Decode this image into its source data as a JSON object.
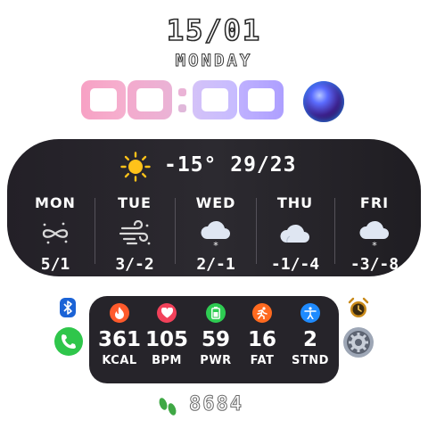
{
  "header": {
    "date": "15/01",
    "day": "MONDAY"
  },
  "clock": {
    "hours": "00",
    "minutes": "00"
  },
  "weather": {
    "current_icon": "sun-icon",
    "current_text": "-15° 29/23",
    "days": [
      {
        "name": "MON",
        "icon": "wind-swirl-icon",
        "temp": "5/1"
      },
      {
        "name": "TUE",
        "icon": "windy-icon",
        "temp": "3/-2"
      },
      {
        "name": "WED",
        "icon": "snow-cloud-icon",
        "temp": "2/-1"
      },
      {
        "name": "THU",
        "icon": "cloud-icon",
        "temp": "-1/-4"
      },
      {
        "name": "FRI",
        "icon": "snow-cloud-icon",
        "temp": "-3/-8"
      }
    ]
  },
  "stats": [
    {
      "icon": "flame-icon",
      "value": "361",
      "label": "KCAL",
      "color": "#ff5a2b"
    },
    {
      "icon": "heart-icon",
      "value": "105",
      "label": "BPM",
      "color": "#f2415a"
    },
    {
      "icon": "battery-icon",
      "value": "59",
      "label": "PWR",
      "color": "#2ecc52"
    },
    {
      "icon": "running-icon",
      "value": "16",
      "label": "FAT",
      "color": "#ff6a1f"
    },
    {
      "icon": "accessibility-icon",
      "value": "2",
      "label": "STND",
      "color": "#1f8bff"
    }
  ],
  "side_icons": [
    "bluetooth-icon",
    "phone-icon",
    "alarm-icon",
    "settings-icon",
    "assistant-orb-icon"
  ],
  "steps": {
    "icon": "footsteps-icon",
    "value": "8684"
  },
  "colors": {
    "panel": "#26242a",
    "digit_gradient": [
      "#f7a6c8",
      "#f2b6d4",
      "#cfc4ff",
      "#b9a8ff"
    ]
  }
}
